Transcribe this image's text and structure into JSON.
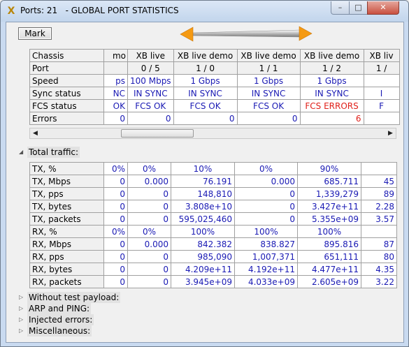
{
  "window": {
    "icon": "tool-x-icon",
    "title": "Ports: 21   - GLOBAL PORT STATISTICS",
    "controls": {
      "minimize": "–",
      "maximize": "□",
      "close": "✕"
    }
  },
  "toolbar": {
    "mark_label": "Mark"
  },
  "ports_table": {
    "corner_label": "Chassis",
    "columns": [
      {
        "chassis": "mo",
        "port": "",
        "speed": "ps",
        "sync": "NC",
        "fcs": "OK",
        "errors": "0"
      },
      {
        "chassis": "XB live",
        "port": "0 / 5",
        "speed": "100 Mbps",
        "sync": "IN SYNC",
        "fcs": "FCS OK",
        "errors": "0"
      },
      {
        "chassis": "XB live demo",
        "port": "1 / 0",
        "speed": "1 Gbps",
        "sync": "IN SYNC",
        "fcs": "FCS OK",
        "errors": "0"
      },
      {
        "chassis": "XB live demo",
        "port": "1 / 1",
        "speed": "1 Gbps",
        "sync": "IN SYNC",
        "fcs": "FCS OK",
        "errors": "0"
      },
      {
        "chassis": "XB live demo",
        "port": "1 / 2",
        "speed": "1 Gbps",
        "sync": "IN SYNC",
        "fcs": "FCS ERRORS",
        "errors": "6"
      },
      {
        "chassis": "XB liv",
        "port": "1 /",
        "speed": "",
        "sync": "I",
        "fcs": "F",
        "errors": ""
      }
    ],
    "row_labels": {
      "port": "Port",
      "speed": "Speed",
      "sync": "Sync status",
      "fcs": "FCS status",
      "errors": "Errors"
    },
    "error_color": "#e0201a",
    "value_color": "#1a1ab4"
  },
  "scrollbar": {
    "left": "◀",
    "right": "▶"
  },
  "sections": {
    "total_traffic": {
      "label": "Total traffic:",
      "expanded": true
    },
    "without_payload": {
      "label": "Without test payload:",
      "expanded": false
    },
    "arp_ping": {
      "label": "ARP and PING:",
      "expanded": false
    },
    "injected_errors": {
      "label": "Injected errors:",
      "expanded": false
    },
    "misc": {
      "label": "Miscellaneous:",
      "expanded": false
    }
  },
  "traffic_table": {
    "rows": [
      {
        "label": "TX, %",
        "values": [
          "0%",
          "0%",
          "10%",
          "0%",
          "90%",
          ""
        ]
      },
      {
        "label": "TX, Mbps",
        "values": [
          "0",
          "0.000",
          "76.191",
          "0.000",
          "685.711",
          "45"
        ]
      },
      {
        "label": "TX, pps",
        "values": [
          "0",
          "0",
          "148,810",
          "0",
          "1,339,279",
          "89"
        ]
      },
      {
        "label": "TX, bytes",
        "values": [
          "0",
          "0",
          "3.808e+10",
          "0",
          "3.427e+11",
          "2.28"
        ]
      },
      {
        "label": "TX, packets",
        "values": [
          "0",
          "0",
          "595,025,460",
          "0",
          "5.355e+09",
          "3.57"
        ]
      },
      {
        "label": "RX, %",
        "values": [
          "0%",
          "0%",
          "100%",
          "100%",
          "100%",
          ""
        ]
      },
      {
        "label": "RX, Mbps",
        "values": [
          "0",
          "0.000",
          "842.382",
          "838.827",
          "895.816",
          "87"
        ]
      },
      {
        "label": "RX, pps",
        "values": [
          "0",
          "0",
          "985,090",
          "1,007,371",
          "651,111",
          "80"
        ]
      },
      {
        "label": "RX, bytes",
        "values": [
          "0",
          "0",
          "4.209e+11",
          "4.192e+11",
          "4.477e+11",
          "4.35"
        ]
      },
      {
        "label": "RX, packets",
        "values": [
          "0",
          "0",
          "3.945e+09",
          "4.033e+09",
          "2.605e+09",
          "3.22"
        ]
      }
    ]
  },
  "icons": {
    "expanded_triangle": "◢",
    "collapsed_triangle": "▷"
  }
}
